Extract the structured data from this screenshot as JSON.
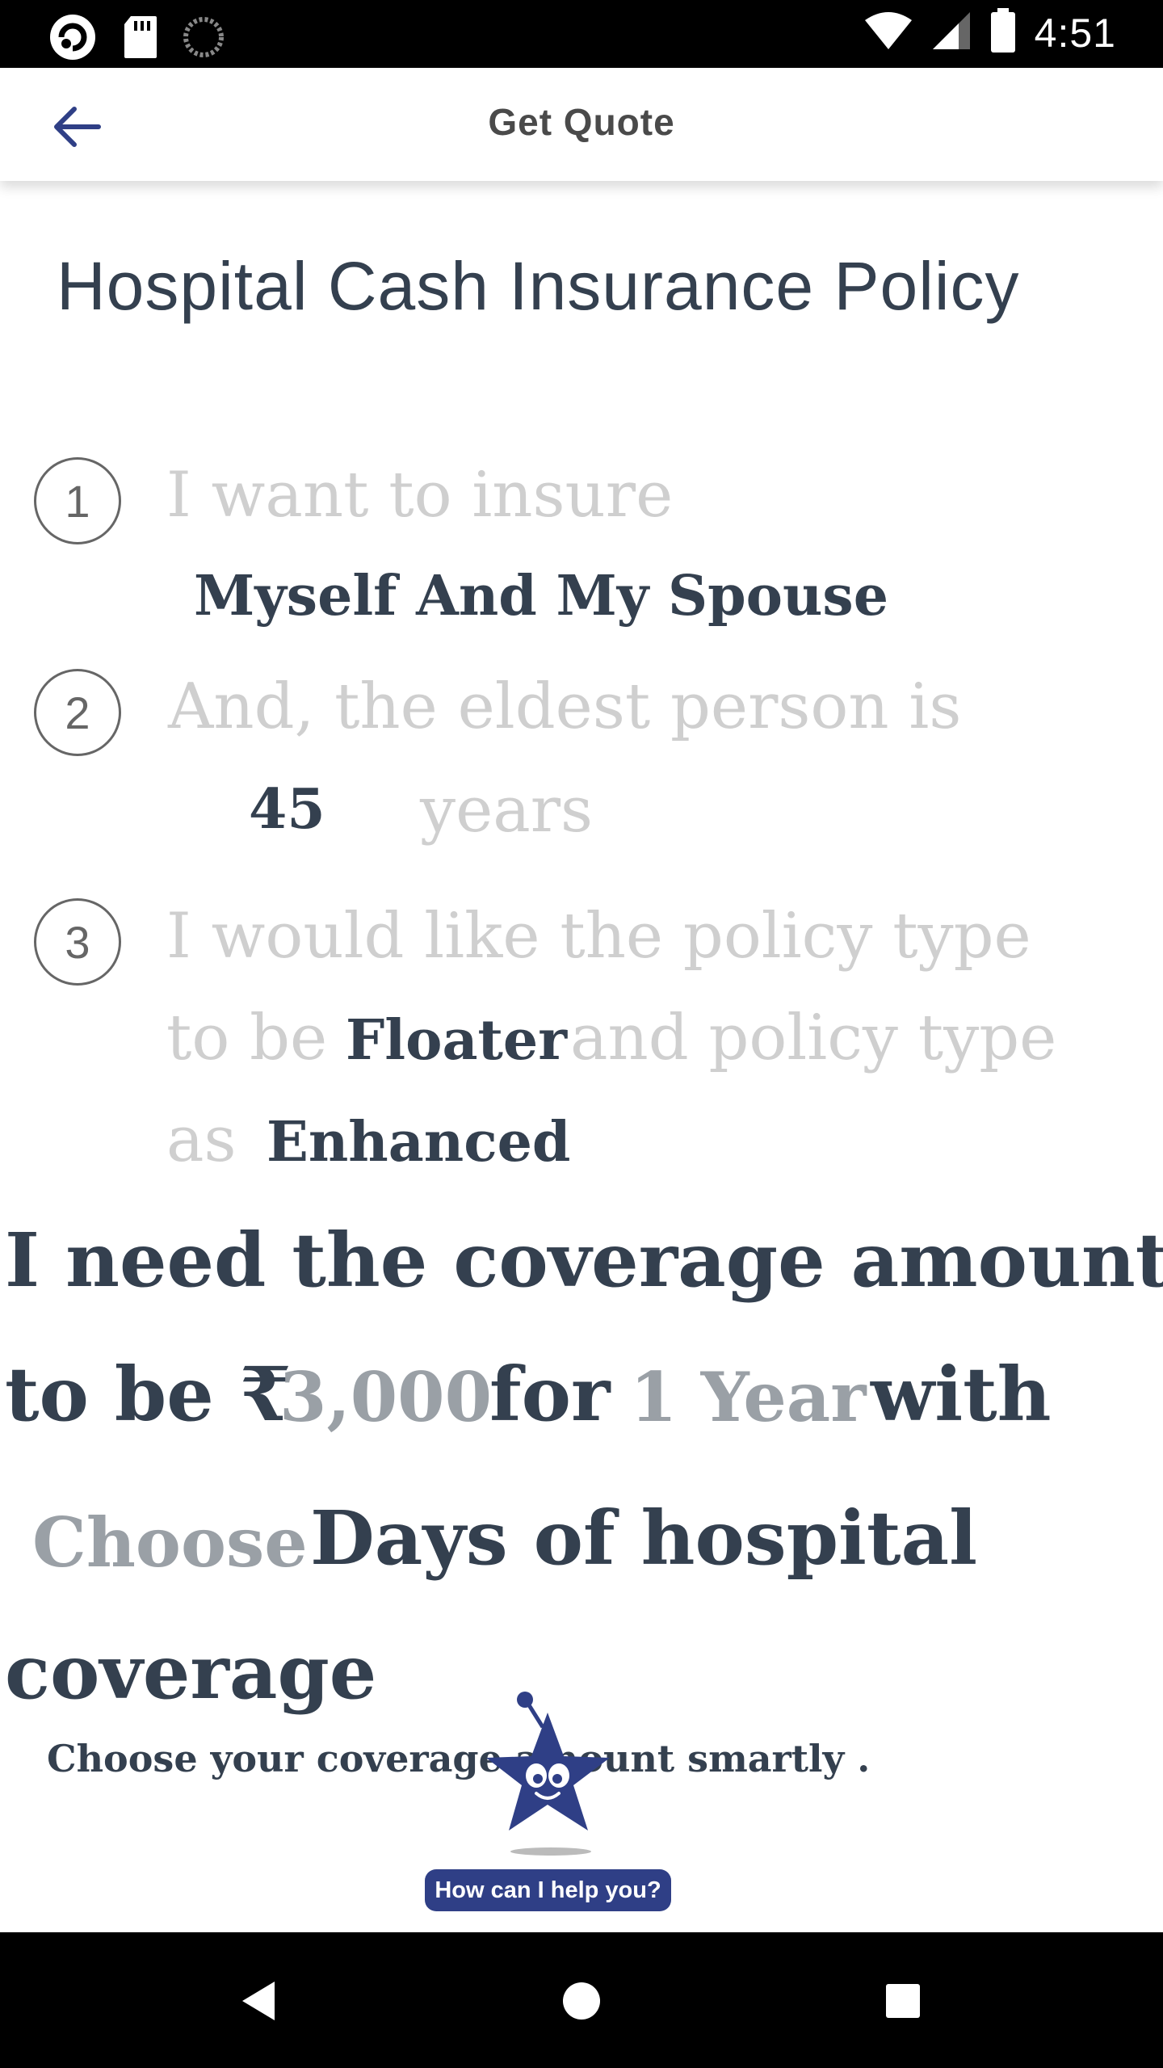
{
  "status_bar": {
    "time": "4:51",
    "icons": [
      "app-icon",
      "sd-card-icon",
      "sync-icon",
      "wifi-icon",
      "signal-icon",
      "battery-icon"
    ]
  },
  "app_bar": {
    "title": "Get Quote",
    "back_icon": "arrow-left-icon",
    "accent": "#2f3f86"
  },
  "page_title": "Hospital Cash Insurance Policy",
  "steps": [
    {
      "number": "1",
      "prefix": "I want to insure",
      "value": "Myself And My Spouse"
    },
    {
      "number": "2",
      "prefix": "And, the eldest person is",
      "value": "45",
      "suffix": "years"
    },
    {
      "number": "3",
      "line1": "I would like the policy type",
      "line2_prefix": "to be",
      "value1": "Floater",
      "line2_suffix": "and policy type",
      "line3_prefix": "as",
      "value2": "Enhanced"
    }
  ],
  "coverage": {
    "line1": "I need the coverage amount",
    "to_be": "to be ₹",
    "amount": "3,000",
    "for": "for",
    "duration": "1 Year",
    "with": "with",
    "days_value": "Choose",
    "days_label": "Days of hospital",
    "line4": "coverage"
  },
  "hint": "Choose your coverage amount smartly .",
  "assistant": {
    "label": "How can I help you?",
    "icon": "star-mascot-icon"
  },
  "nav": [
    "back-nav-icon",
    "home-nav-icon",
    "recents-nav-icon"
  ],
  "colors": {
    "primary_text": "#34404f",
    "muted_text": "#cfcfcf",
    "value_muted": "#9aa0a6"
  }
}
